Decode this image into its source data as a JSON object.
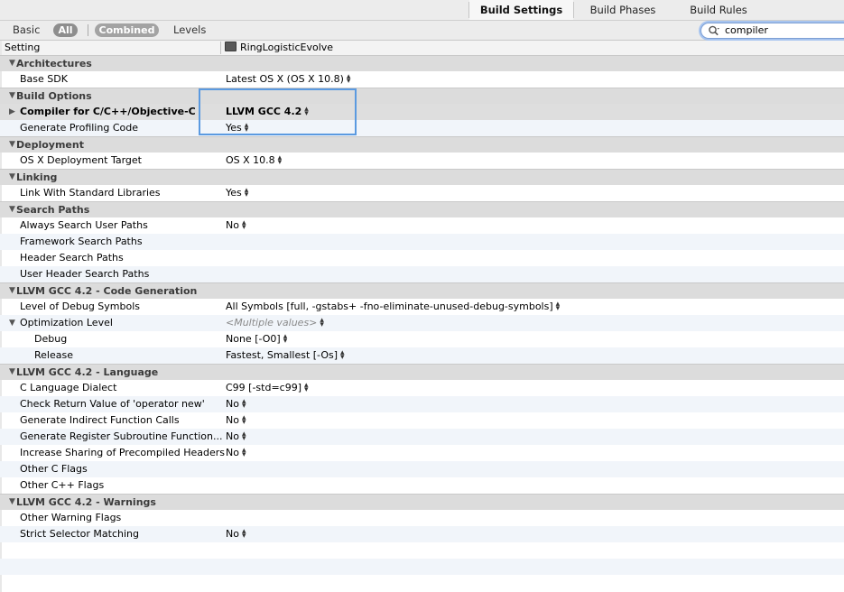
{
  "tabs": [
    {
      "label": "Build Settings",
      "selected": true
    },
    {
      "label": "Build Phases",
      "selected": false
    },
    {
      "label": "Build Rules",
      "selected": false
    }
  ],
  "filter": {
    "basic": "Basic",
    "all": "All",
    "combined": "Combined",
    "levels": "Levels",
    "search_value": "compiler"
  },
  "columns": {
    "setting": "Setting",
    "target": "RingLogisticEvolve"
  },
  "rows": [
    {
      "type": "group",
      "label": "Architectures"
    },
    {
      "type": "item",
      "label": "Base SDK",
      "value": "Latest OS X (OS X 10.8)",
      "stepper": true
    },
    {
      "type": "group",
      "label": "Build Options"
    },
    {
      "type": "item",
      "label": "Compiler for C/C++/Objective-C",
      "value": "LLVM GCC 4.2",
      "stepper": true,
      "bold": true,
      "collapsed": true,
      "highlight": true
    },
    {
      "type": "item",
      "label": "Generate Profiling Code",
      "value": "Yes",
      "stepper": true
    },
    {
      "type": "group",
      "label": "Deployment"
    },
    {
      "type": "item",
      "label": "OS X Deployment Target",
      "value": "OS X 10.8",
      "stepper": true
    },
    {
      "type": "group",
      "label": "Linking"
    },
    {
      "type": "item",
      "label": "Link With Standard Libraries",
      "value": "Yes",
      "stepper": true
    },
    {
      "type": "group",
      "label": "Search Paths"
    },
    {
      "type": "item",
      "label": "Always Search User Paths",
      "value": "No",
      "stepper": true
    },
    {
      "type": "item",
      "label": "Framework Search Paths",
      "value": ""
    },
    {
      "type": "item",
      "label": "Header Search Paths",
      "value": ""
    },
    {
      "type": "item",
      "label": "User Header Search Paths",
      "value": ""
    },
    {
      "type": "group",
      "label": "LLVM GCC 4.2 - Code Generation"
    },
    {
      "type": "item",
      "label": "Level of Debug Symbols",
      "value": "All Symbols [full, -gstabs+ -fno-eliminate-unused-debug-symbols]",
      "stepper": true
    },
    {
      "type": "item",
      "label": "Optimization Level",
      "value": "<Multiple values>",
      "stepper": true,
      "expanded": true,
      "gray": true
    },
    {
      "type": "item",
      "label": "Debug",
      "value": "None [-O0]",
      "stepper": true,
      "indent": true
    },
    {
      "type": "item",
      "label": "Release",
      "value": "Fastest, Smallest [-Os]",
      "stepper": true,
      "indent": true
    },
    {
      "type": "group",
      "label": "LLVM GCC 4.2 - Language"
    },
    {
      "type": "item",
      "label": "C Language Dialect",
      "value": "C99 [-std=c99]",
      "stepper": true
    },
    {
      "type": "item",
      "label": "Check Return Value of 'operator new'",
      "value": "No",
      "stepper": true
    },
    {
      "type": "item",
      "label": "Generate Indirect Function Calls",
      "value": "No",
      "stepper": true
    },
    {
      "type": "item",
      "label": "Generate Register Subroutine Function...",
      "value": "No",
      "stepper": true
    },
    {
      "type": "item",
      "label": "Increase Sharing of Precompiled Headers",
      "value": "No",
      "stepper": true
    },
    {
      "type": "item",
      "label": "Other C Flags",
      "value": ""
    },
    {
      "type": "item",
      "label": "Other C++ Flags",
      "value": ""
    },
    {
      "type": "group",
      "label": "LLVM GCC 4.2 - Warnings"
    },
    {
      "type": "item",
      "label": "Other Warning Flags",
      "value": ""
    },
    {
      "type": "item",
      "label": "Strict Selector Matching",
      "value": "No",
      "stepper": true
    },
    {
      "type": "empty"
    },
    {
      "type": "empty"
    },
    {
      "type": "empty"
    }
  ]
}
